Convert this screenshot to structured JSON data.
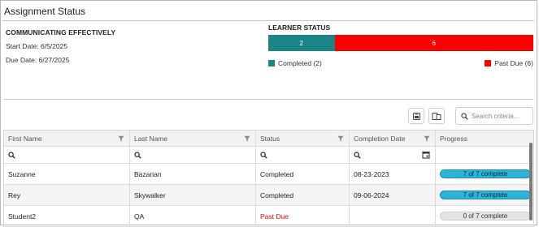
{
  "app": {
    "title": "Assignment Status"
  },
  "assignment": {
    "name": "COMMUNICATING EFFECTIVELY",
    "start_date": "Start Date: 6/5/2025",
    "due_date": "Due Date: 6/27/2025"
  },
  "learner_status": {
    "title": "LEARNER STATUS",
    "completed_count": "2",
    "past_due_count": "6",
    "completed_fraction": 0.25,
    "legend_completed": "Completed (2)",
    "legend_past_due": "Past Due (6)",
    "colors": {
      "completed": "#1a8585",
      "past_due": "#ff0000"
    }
  },
  "toolbar": {
    "export_icon": "export-icon",
    "columns_icon": "column-chooser-icon",
    "search_placeholder": "Search criteria..."
  },
  "table": {
    "columns": [
      "First Name",
      "Last Name",
      "Status",
      "Completion Date",
      "Progress"
    ],
    "rows": [
      {
        "first": "Suzanne",
        "last": "Bazarian",
        "status": "Completed",
        "date": "08-23-2023",
        "progress": "7 of 7 complete",
        "progress_fraction": 1.0
      },
      {
        "first": "Rey",
        "last": "Skywalker",
        "status": "Completed",
        "date": "09-06-2024",
        "progress": "7 of 7 complete",
        "progress_fraction": 1.0
      },
      {
        "first": "Student2",
        "last": "QA",
        "status": "Past Due",
        "date": "",
        "progress": "0 of 7 complete",
        "progress_fraction": 0.0
      }
    ]
  }
}
